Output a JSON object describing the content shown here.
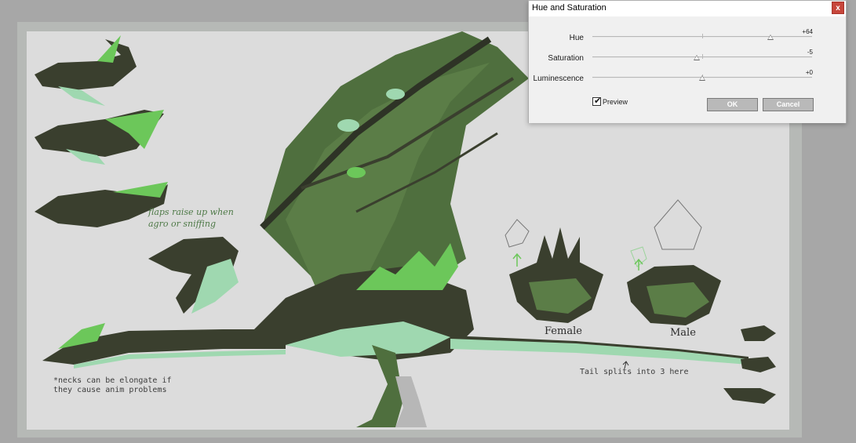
{
  "dialog": {
    "title": "Hue and Saturation",
    "close_label": "x",
    "sliders": [
      {
        "name": "hue",
        "label": "Hue",
        "value_text": "+64",
        "position": 0.81
      },
      {
        "name": "saturation",
        "label": "Saturation",
        "value_text": "-5",
        "position": 0.475
      },
      {
        "name": "luminescence",
        "label": "Luminescence",
        "value_text": "+0",
        "position": 0.5
      }
    ],
    "preview": {
      "label": "Preview",
      "checked": true,
      "check_glyph": "✔"
    },
    "ok_label": "OK",
    "cancel_label": "Cancel"
  },
  "artwork": {
    "annotations": {
      "flaps": "flaps raise up when\nagro or sniffing",
      "necks": "*necks can be elongate if\nthey cause anim problems",
      "tail": "Tail splits into 3 here",
      "female": "Female",
      "male": "Male"
    },
    "colors": {
      "dark": "#3a3f2e",
      "mid": "#4f6f3e",
      "light_green": "#6cc75a",
      "pale_green": "#9fd8b0",
      "accent": "#5fd35a"
    }
  }
}
